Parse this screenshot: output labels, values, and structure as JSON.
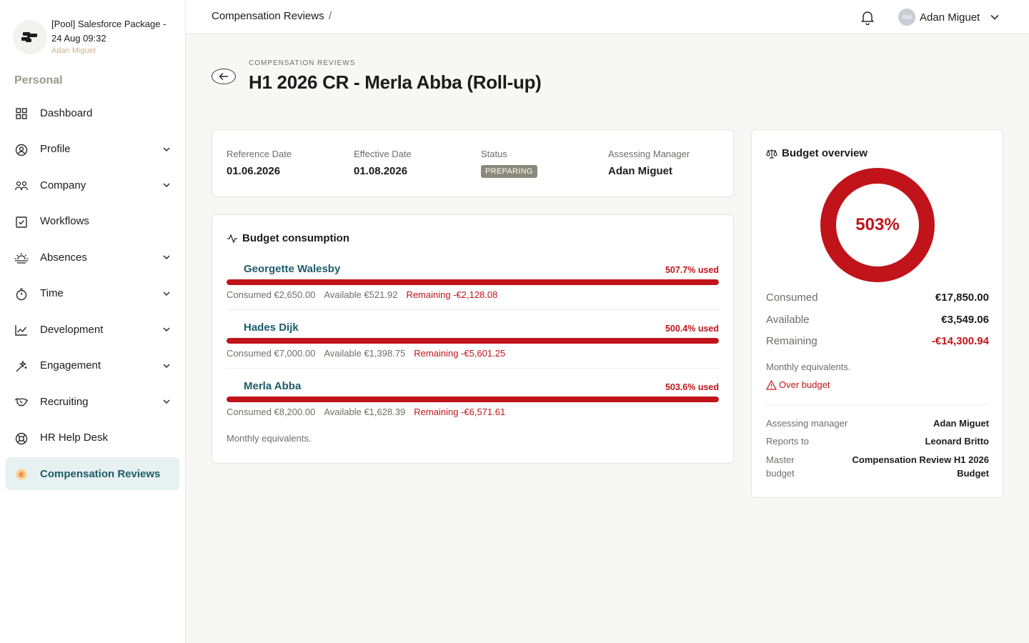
{
  "sidebar": {
    "org_name": "[Pool] Salesforce Package - 24 Aug 09:32",
    "org_user": "Adan Miguet",
    "section_title": "Personal",
    "items": [
      {
        "label": "Dashboard",
        "icon": "grid-icon",
        "expandable": false
      },
      {
        "label": "Profile",
        "icon": "user-circle-icon",
        "expandable": true
      },
      {
        "label": "Company",
        "icon": "users-icon",
        "expandable": true
      },
      {
        "label": "Workflows",
        "icon": "checkbox-icon",
        "expandable": false
      },
      {
        "label": "Absences",
        "icon": "sunrise-icon",
        "expandable": true
      },
      {
        "label": "Time",
        "icon": "stopwatch-icon",
        "expandable": true
      },
      {
        "label": "Development",
        "icon": "chart-line-icon",
        "expandable": true
      },
      {
        "label": "Engagement",
        "icon": "sparkle-wand-icon",
        "expandable": true
      },
      {
        "label": "Recruiting",
        "icon": "handshake-icon",
        "expandable": true
      },
      {
        "label": "HR Help Desk",
        "icon": "lifebuoy-icon",
        "expandable": false
      },
      {
        "label": "Compensation Reviews",
        "icon": "coin-icon",
        "expandable": false,
        "active": true
      }
    ]
  },
  "topbar": {
    "breadcrumb": "Compensation Reviews",
    "breadcrumb_sep": "/",
    "user_initials": "AM",
    "user_name": "Adan Miguet"
  },
  "header": {
    "eyebrow": "COMPENSATION REVIEWS",
    "title": "H1 2026 CR - Merla Abba (Roll-up)"
  },
  "info": {
    "reference_date_label": "Reference Date",
    "reference_date": "01.06.2026",
    "effective_date_label": "Effective Date",
    "effective_date": "01.08.2026",
    "status_label": "Status",
    "status": "PREPARING",
    "manager_label": "Assessing Manager",
    "manager": "Adan Miguet"
  },
  "consumption": {
    "title": "Budget consumption",
    "rows": [
      {
        "name": "Georgette Walesby",
        "pct": "507.7% used",
        "pct_value": 507.7,
        "consumed": "Consumed €2,650.00",
        "available": "Available €521.92",
        "remaining": "Remaining -€2,128.08"
      },
      {
        "name": "Hades Dijk",
        "pct": "500.4% used",
        "pct_value": 500.4,
        "consumed": "Consumed €7,000.00",
        "available": "Available €1,398.75",
        "remaining": "Remaining -€5,601.25"
      },
      {
        "name": "Merla Abba",
        "pct": "503.6% used",
        "pct_value": 503.6,
        "consumed": "Consumed €8,200.00",
        "available": "Available €1,628.39",
        "remaining": "Remaining -€6,571.61"
      }
    ],
    "note": "Monthly equivalents."
  },
  "overview": {
    "title": "Budget overview",
    "percent": "503%",
    "percent_value": 503,
    "consumed_label": "Consumed",
    "consumed": "€17,850.00",
    "available_label": "Available",
    "available": "€3,549.06",
    "remaining_label": "Remaining",
    "remaining": "-€14,300.94",
    "note": "Monthly equivalents.",
    "warning": "Over budget",
    "assessing_manager_label": "Assessing manager",
    "assessing_manager": "Adan Miguet",
    "reports_to_label": "Reports to",
    "reports_to": "Leonard Britto",
    "master_budget_label": "Master budget",
    "master_budget": "Compensation Review H1 2026 Budget"
  },
  "colors": {
    "accent": "#1c5c6a",
    "danger": "#c0141a",
    "status_badge": "#8a8a7a",
    "active_bg": "#e8f1f2"
  }
}
